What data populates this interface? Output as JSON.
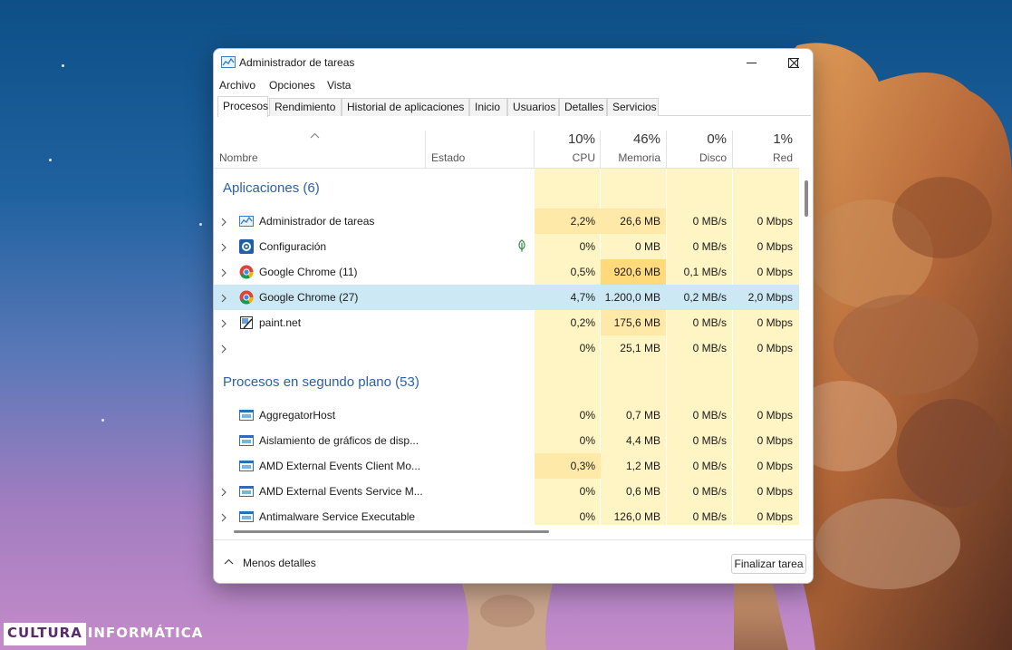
{
  "window": {
    "title": "Administrador de tareas",
    "minimize_glyph": "minimize-icon",
    "maximize_glyph": "maximize-icon",
    "close_glyph": "close-icon"
  },
  "menu": [
    "Archivo",
    "Opciones",
    "Vista"
  ],
  "tabs": [
    {
      "label": "Procesos",
      "active": true
    },
    {
      "label": "Rendimiento",
      "active": false
    },
    {
      "label": "Historial de aplicaciones",
      "active": false
    },
    {
      "label": "Inicio",
      "active": false
    },
    {
      "label": "Usuarios",
      "active": false
    },
    {
      "label": "Detalles",
      "active": false
    },
    {
      "label": "Servicios",
      "active": false
    }
  ],
  "columns": {
    "name": "Nombre",
    "status": "Estado",
    "cpu": {
      "pct": "10%",
      "label": "CPU"
    },
    "memory": {
      "pct": "46%",
      "label": "Memoria"
    },
    "disk": {
      "pct": "0%",
      "label": "Disco"
    },
    "network": {
      "pct": "1%",
      "label": "Red"
    }
  },
  "groups": {
    "apps": "Aplicaciones (6)",
    "background": "Procesos en segundo plano (53)"
  },
  "apps": [
    {
      "name": "Administrador de tareas",
      "icon": "task-manager-icon",
      "cpu": "2,2%",
      "mem": "26,6 MB",
      "disk": "0 MB/s",
      "net": "0 Mbps"
    },
    {
      "name": "Configuración",
      "icon": "settings-icon",
      "cpu": "0%",
      "mem": "0 MB",
      "disk": "0 MB/s",
      "net": "0 Mbps",
      "status_icon": "efficiency-leaf-icon"
    },
    {
      "name": "Google Chrome (11)",
      "icon": "chrome-icon",
      "cpu": "0,5%",
      "mem": "920,6 MB",
      "disk": "0,1 MB/s",
      "net": "0 Mbps"
    },
    {
      "name": "Google Chrome (27)",
      "icon": "chrome-icon",
      "cpu": "4,7%",
      "mem": "1.200,0 MB",
      "disk": "0,2 MB/s",
      "net": "2,0 Mbps",
      "selected": true
    },
    {
      "name": "paint.net",
      "icon": "paintnet-icon",
      "cpu": "0,2%",
      "mem": "175,6 MB",
      "disk": "0 MB/s",
      "net": "0 Mbps"
    },
    {
      "name": "",
      "icon": "",
      "cpu": "0%",
      "mem": "25,1 MB",
      "disk": "0 MB/s",
      "net": "0 Mbps"
    }
  ],
  "background": [
    {
      "name": "AggregatorHost",
      "expandable": false,
      "cpu": "0%",
      "mem": "0,7 MB",
      "disk": "0 MB/s",
      "net": "0 Mbps"
    },
    {
      "name": "Aislamiento de gráficos de disp...",
      "expandable": false,
      "cpu": "0%",
      "mem": "4,4 MB",
      "disk": "0 MB/s",
      "net": "0 Mbps"
    },
    {
      "name": "AMD External Events Client Mo...",
      "expandable": false,
      "cpu": "0,3%",
      "mem": "1,2 MB",
      "disk": "0 MB/s",
      "net": "0 Mbps"
    },
    {
      "name": "AMD External Events Service M...",
      "expandable": true,
      "cpu": "0%",
      "mem": "0,6 MB",
      "disk": "0 MB/s",
      "net": "0 Mbps"
    },
    {
      "name": "Antimalware Service Executable",
      "expandable": true,
      "cpu": "0%",
      "mem": "126,0 MB",
      "disk": "0 MB/s",
      "net": "0 Mbps"
    }
  ],
  "footer": {
    "less_details": "Menos detalles",
    "end_task": "Finalizar tarea"
  },
  "watermark": {
    "part1": "CULTURA",
    "part2": "INFORMÁTICA"
  },
  "colors": {
    "heat_low": "#fff4c4",
    "heat_mid": "#ffe9a8",
    "heat_high": "#ffd97a",
    "selection": "#cce8f4",
    "group_text": "#2b5fa8"
  }
}
